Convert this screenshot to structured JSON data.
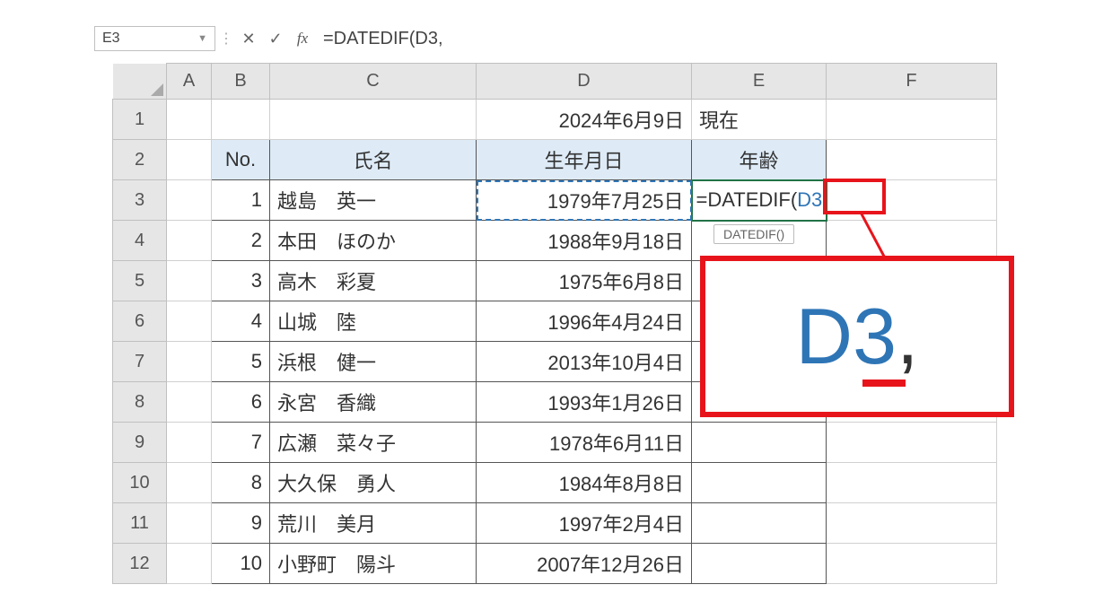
{
  "formula_bar": {
    "cell_ref": "E3",
    "cancel": "✕",
    "confirm": "✓",
    "fx_label": "fx",
    "formula_text": "=DATEDIF(D3,"
  },
  "columns": {
    "A": "A",
    "B": "B",
    "C": "C",
    "D": "D",
    "E": "E",
    "F": "F"
  },
  "row_labels": [
    "1",
    "2",
    "3",
    "4",
    "5",
    "6",
    "7",
    "8",
    "9",
    "10",
    "11",
    "12"
  ],
  "row1": {
    "D": "2024年6月9日",
    "E": "現在"
  },
  "headers": {
    "no": "No.",
    "name": "氏名",
    "dob": "生年月日",
    "age": "年齢"
  },
  "editing": {
    "prefix": "=DATEDIF(",
    "ref": "D3",
    "suffix": ","
  },
  "tooltip": "DATEDIF()",
  "rows": [
    {
      "no": "1",
      "name": "越島　英一",
      "dob": "1979年7月25日"
    },
    {
      "no": "2",
      "name": "本田　ほのか",
      "dob": "1988年9月18日"
    },
    {
      "no": "3",
      "name": "高木　彩夏",
      "dob": "1975年6月8日"
    },
    {
      "no": "4",
      "name": "山城　陸",
      "dob": "1996年4月24日"
    },
    {
      "no": "5",
      "name": "浜根　健一",
      "dob": "2013年10月4日"
    },
    {
      "no": "6",
      "name": "永宮　香織",
      "dob": "1993年1月26日"
    },
    {
      "no": "7",
      "name": "広瀬　菜々子",
      "dob": "1978年6月11日"
    },
    {
      "no": "8",
      "name": "大久保　勇人",
      "dob": "1984年8月8日"
    },
    {
      "no": "9",
      "name": "荒川　美月",
      "dob": "1997年2月4日"
    },
    {
      "no": "10",
      "name": "小野町　陽斗",
      "dob": "2007年12月26日"
    }
  ],
  "callout": {
    "ref": "D3",
    "comma": ","
  }
}
